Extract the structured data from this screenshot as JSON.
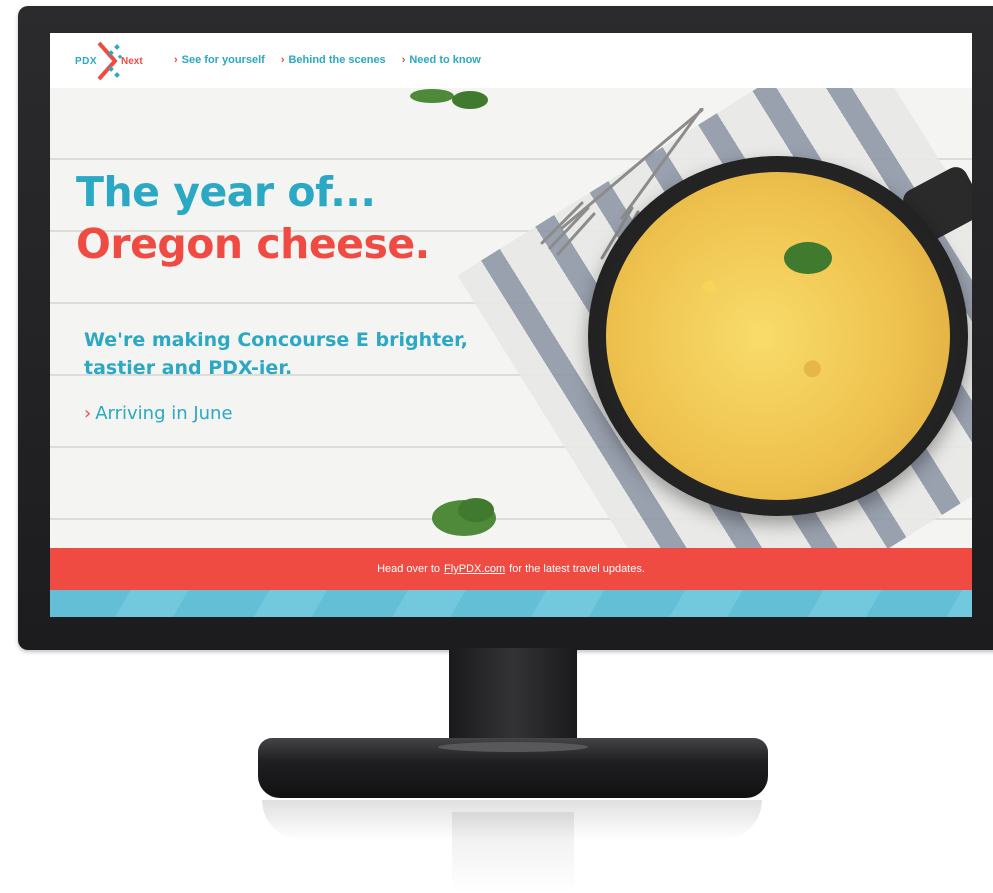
{
  "logo": {
    "left": "PDX",
    "right": "Next"
  },
  "nav": [
    {
      "label": "See for yourself"
    },
    {
      "label": "Behind the scenes"
    },
    {
      "label": "Need to know"
    }
  ],
  "hero": {
    "line1": "The year of...",
    "line2": "Oregon cheese.",
    "subhead": "We're making Concourse E brighter, tastier and PDX-ier.",
    "cta": "Arriving in June"
  },
  "banner": {
    "before": "Head over to",
    "link": "FlyPDX.com",
    "after": "for the latest travel updates."
  },
  "colors": {
    "teal": "#2aa8c4",
    "coral": "#f04b42",
    "stripe": "#63bfd6"
  }
}
